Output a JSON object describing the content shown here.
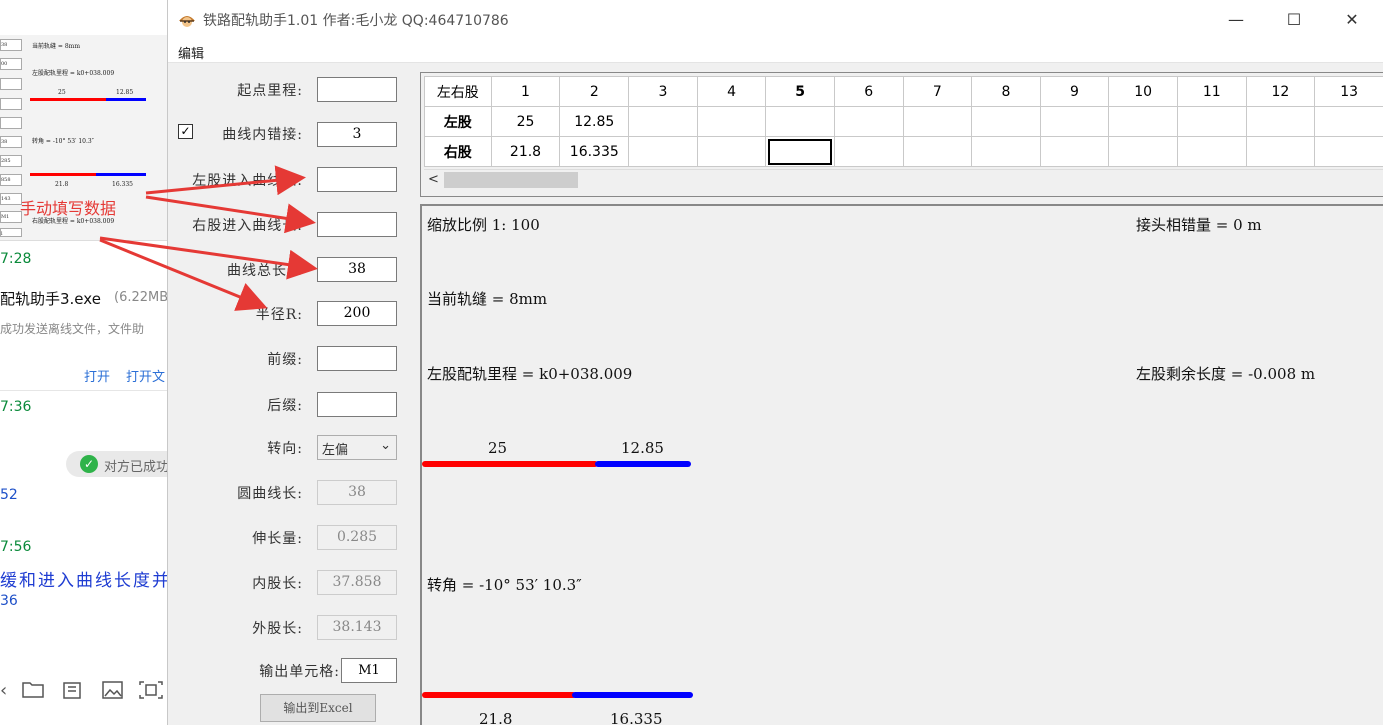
{
  "background_app": {
    "thumbnail": {
      "fields": [
        "38",
        "00",
        "",
        "",
        "",
        "38",
        "285",
        "858",
        "143",
        "M1",
        "l"
      ],
      "current_gap": "当前轨缝 = 8mm",
      "left_mileage": "左股配轨里程 = k0+038.009",
      "top_rail_values": [
        "25",
        "12.85"
      ],
      "angle": "转角 = -10° 53′ 10.3″",
      "bottom_rail_values": [
        "21.8",
        "16.335"
      ],
      "right_mileage": "右股配轨里程 = k0+038.009"
    },
    "time_1": "7:28",
    "file_name": "配轨助手3.exe",
    "file_size": "(6.22MB",
    "file_desc": "成功发送离线文件，文件助",
    "link_open": "打开",
    "link_open_folder": "打开文",
    "time_2": "7:36",
    "sent_status": "对方已成功",
    "num_1": "52",
    "time_3": "7:56",
    "blue_text": "缓和进入曲线长度并",
    "num_2": "36"
  },
  "window": {
    "title": "铁路配轨助手1.01 作者:毛小龙 QQ:464710786",
    "min_glyph": "—",
    "max_glyph": "☐",
    "close_glyph": "✕"
  },
  "menu": {
    "edit": "编辑"
  },
  "form": {
    "start_mileage_label": "起点里程:",
    "start_mileage_value": "",
    "inner_joint_checked": true,
    "inner_joint_check_glyph": "✓",
    "inner_joint_label": "曲线内错接:",
    "inner_joint_value": "3",
    "left_enter_label": "左股进入曲线长:",
    "left_enter_value": "",
    "right_enter_label": "右股进入曲线长:",
    "right_enter_value": "",
    "total_length_label": "曲线总长L:",
    "total_length_value": "38",
    "radius_label": "半径R:",
    "radius_value": "200",
    "prefix_label": "前缀:",
    "prefix_value": "",
    "suffix_label": "后缀:",
    "suffix_value": "",
    "direction_label": "转向:",
    "direction_value": "左偏",
    "direction_arrow": "⌄",
    "circle_length_label": "圆曲线长:",
    "circle_length_value": "38",
    "elongation_label": "伸长量:",
    "elongation_value": "0.285",
    "inner_length_label": "内股长:",
    "inner_length_value": "37.858",
    "outer_length_label": "外股长:",
    "outer_length_value": "38.143",
    "output_cell_label": "输出单元格:",
    "output_cell_value": "M1",
    "export_button": "输出到Excel"
  },
  "grid": {
    "corner": "左右股",
    "columns": [
      "1",
      "2",
      "3",
      "4",
      "5",
      "6",
      "7",
      "8",
      "9",
      "10",
      "11",
      "12",
      "13"
    ],
    "bold_column": "5",
    "rows": [
      {
        "label": "左股",
        "cells": [
          "25",
          "12.85",
          "",
          "",
          "",
          "",
          "",
          "",
          "",
          "",
          "",
          "",
          ""
        ]
      },
      {
        "label": "右股",
        "cells": [
          "21.8",
          "16.335",
          "",
          "",
          "",
          "",
          "",
          "",
          "",
          "",
          "",
          "",
          ""
        ]
      }
    ],
    "scroll_left": "<"
  },
  "canvas": {
    "scale": "缩放比例 1: 100",
    "joint_offset": "接头相错量 = 0 m",
    "current_gap": "当前轨缝 = 8mm",
    "left_mileage": "左股配轨里程 = k0+038.009",
    "left_remaining": "左股剩余长度 = -0.008 m",
    "left_rail_values": [
      "25",
      "12.85"
    ],
    "angle": "转角 = -10° 53′ 10.3″",
    "right_rail_values": [
      "21.8",
      "16.335"
    ]
  },
  "annotation": {
    "text": "手动填写数据",
    "color": "#e53935"
  },
  "colors": {
    "rail_red": "#ff0000",
    "rail_blue": "#0000ff"
  }
}
